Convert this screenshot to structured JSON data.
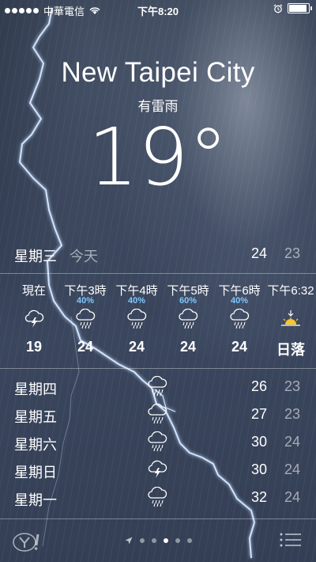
{
  "status_bar": {
    "carrier": "中華電信",
    "time": "下午8:20",
    "battery_level": 0.85
  },
  "location": {
    "city": "New Taipei City",
    "condition": "有雷雨",
    "temperature": "19°"
  },
  "today": {
    "day": "星期三",
    "label": "今天",
    "high": "24",
    "low": "23"
  },
  "hourly": [
    {
      "time": "現在",
      "precip": "",
      "icon": "thunderstorm-icon",
      "temp": "19"
    },
    {
      "time": "下午3時",
      "precip": "40%",
      "icon": "rain-icon",
      "temp": "24"
    },
    {
      "time": "下午4時",
      "precip": "40%",
      "icon": "rain-icon",
      "temp": "24"
    },
    {
      "time": "下午5時",
      "precip": "60%",
      "icon": "rain-icon",
      "temp": "24"
    },
    {
      "time": "下午6時",
      "precip": "40%",
      "icon": "rain-icon",
      "temp": "24"
    },
    {
      "time": "下午6:32",
      "precip": "",
      "icon": "sunset-icon",
      "temp": "日落"
    }
  ],
  "daily": [
    {
      "day": "星期四",
      "icon": "rain-icon",
      "high": "26",
      "low": "23"
    },
    {
      "day": "星期五",
      "icon": "rain-icon",
      "high": "27",
      "low": "23"
    },
    {
      "day": "星期六",
      "icon": "rain-icon",
      "high": "30",
      "low": "24"
    },
    {
      "day": "星期日",
      "icon": "thunderstorm-icon",
      "high": "30",
      "low": "24"
    },
    {
      "day": "星期一",
      "icon": "rain-icon",
      "high": "32",
      "low": "24"
    }
  ],
  "pager": {
    "page_count": 5,
    "current_page": 2
  },
  "colors": {
    "precip_blue": "#7fc8ff",
    "bolt": "#cfe3ff"
  }
}
